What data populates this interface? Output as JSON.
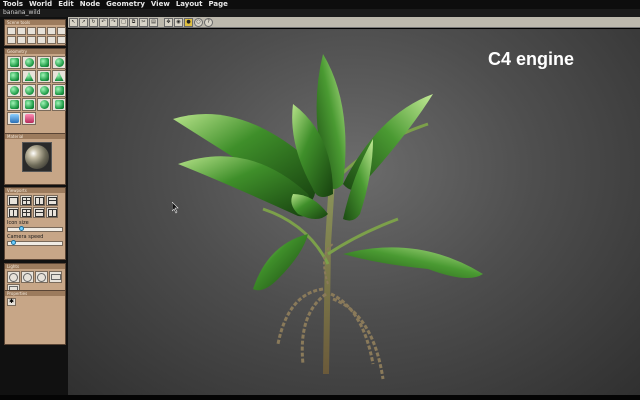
{
  "menu": {
    "items": [
      "Tools",
      "World",
      "Edit",
      "Node",
      "Geometry",
      "View",
      "Layout",
      "Page"
    ]
  },
  "window": {
    "title": "banana_wild"
  },
  "toolbar": {
    "icons": [
      "cursor-icon",
      "cursor-icon",
      "rotate-icon",
      "undo-icon",
      "redo-icon",
      "scale-icon",
      "duplicate-icon",
      "clip-icon",
      "paste-icon",
      "move-icon",
      "view-icon",
      "camera-icon",
      "light-icon",
      "help-icon"
    ]
  },
  "panels": {
    "scene_tools": {
      "title": "Scene tools"
    },
    "geometry": {
      "title": "Geometry"
    },
    "material": {
      "title": "Material"
    },
    "viewports": {
      "title": "Viewports",
      "icon_size_label": "Icon size",
      "icon_size_value": 0.2,
      "camera_speed_label": "Camera speed",
      "camera_speed_value": 0.05
    },
    "lights": {
      "title": "Lights"
    },
    "properties": {
      "title": "Properties"
    }
  },
  "viewport": {
    "overlay_text": "C4 engine"
  },
  "colors": {
    "panel_bg": "#c7a687",
    "panel_title": "#9c7b5d",
    "toolbar_bg": "#bdb9ad",
    "viewport_bg": "#5a5a5a",
    "leaf_green": "#3f8f2a"
  }
}
